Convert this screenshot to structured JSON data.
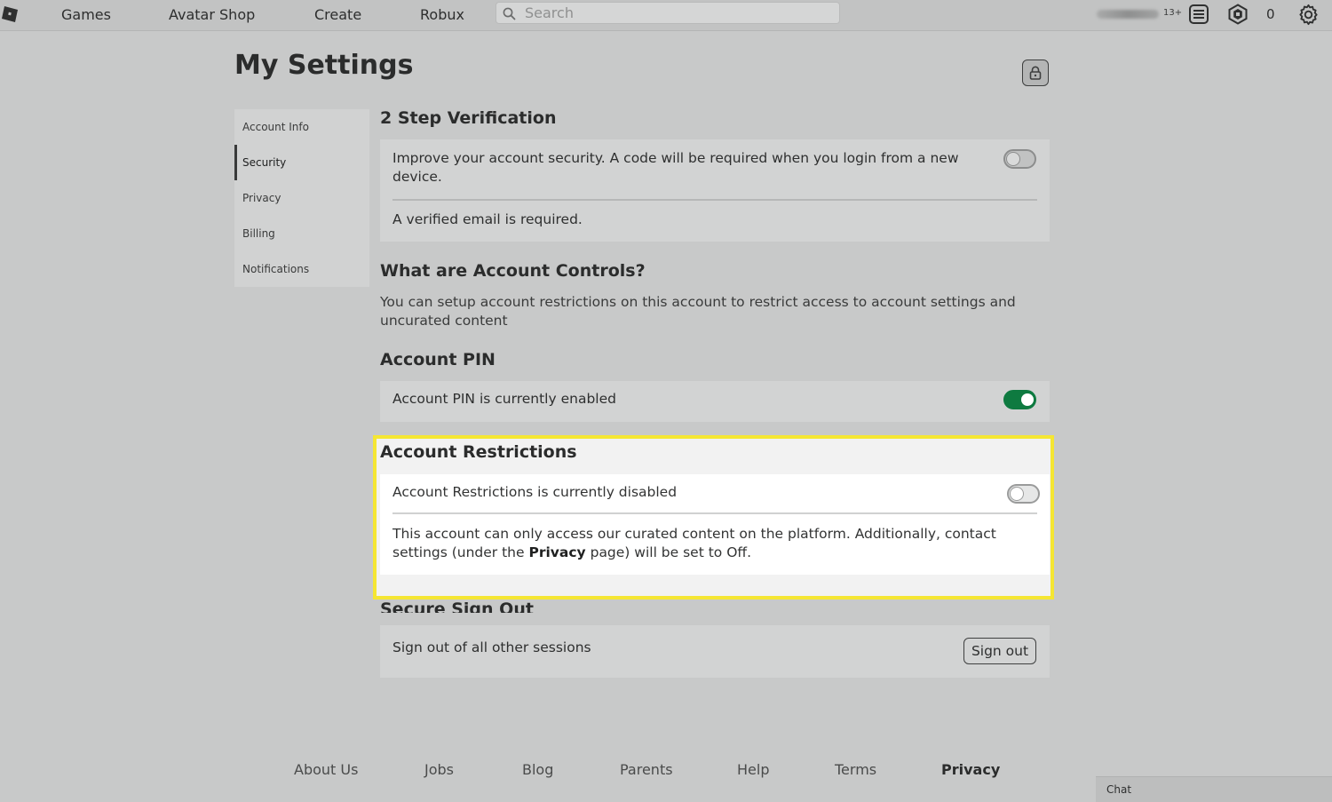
{
  "nav": {
    "links": [
      "Games",
      "Avatar Shop",
      "Create",
      "Robux"
    ],
    "search_placeholder": "Search",
    "age_badge": "13+",
    "robux_count": "0"
  },
  "page": {
    "title": "My Settings"
  },
  "sidebar": {
    "items": [
      {
        "label": "Account Info",
        "active": false
      },
      {
        "label": "Security",
        "active": true
      },
      {
        "label": "Privacy",
        "active": false
      },
      {
        "label": "Billing",
        "active": false
      },
      {
        "label": "Notifications",
        "active": false
      }
    ]
  },
  "two_step": {
    "heading": "2 Step Verification",
    "description": "Improve your account security. A code will be required when you login from a new device.",
    "note": "A verified email is required.",
    "enabled": false
  },
  "account_controls": {
    "heading": "What are Account Controls?",
    "description": "You can setup account restrictions on this account to restrict access to account settings and uncurated content"
  },
  "account_pin": {
    "heading": "Account PIN",
    "status": "Account PIN is currently enabled",
    "enabled": true
  },
  "account_restrictions": {
    "heading": "Account Restrictions",
    "status": "Account Restrictions is currently disabled",
    "enabled": false,
    "desc_before": "This account can only access our curated content on the platform. Additionally, contact settings (under the ",
    "desc_link": "Privacy",
    "desc_after": " page) will be set to Off.",
    "highlight_color": "#f5e633"
  },
  "secure_sign_out": {
    "heading": "Secure Sign Out",
    "description": "Sign out of all other sessions",
    "button_label": "Sign out"
  },
  "footer": {
    "links": [
      "About Us",
      "Jobs",
      "Blog",
      "Parents",
      "Help",
      "Terms",
      "Privacy"
    ]
  },
  "chat": {
    "label": "Chat"
  },
  "colors": {
    "toggle_on": "#0e7a40",
    "highlight": "#f5e633"
  }
}
